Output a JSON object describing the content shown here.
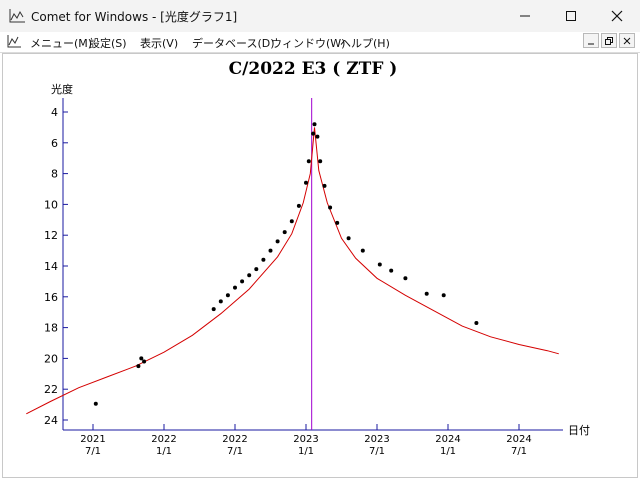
{
  "window": {
    "title": "Comet for Windows - [光度グラフ1]",
    "icon": "chart-icon"
  },
  "menu": {
    "items": [
      "メニュー(M)",
      "設定(S)",
      "表示(V)",
      "データベース(D)",
      "ウィンドウ(W)",
      "ヘルプ(H)"
    ]
  },
  "chart_data": {
    "type": "scatter",
    "title": "C/2022 E3 ( ZTF )",
    "ylabel": "光度",
    "xlabel": "日付",
    "ylim": [
      24,
      4
    ],
    "y_ticks": [
      4,
      6,
      8,
      10,
      12,
      14,
      16,
      18,
      20,
      22,
      24
    ],
    "x_ticks": [
      {
        "year": "2021",
        "date": "7/1",
        "t": 2021.5
      },
      {
        "year": "2022",
        "date": "1/1",
        "t": 2022.0
      },
      {
        "year": "2022",
        "date": "7/1",
        "t": 2022.5
      },
      {
        "year": "2023",
        "date": "1/1",
        "t": 2023.0
      },
      {
        "year": "2023",
        "date": "7/1",
        "t": 2023.5
      },
      {
        "year": "2024",
        "date": "1/1",
        "t": 2024.0
      },
      {
        "year": "2024",
        "date": "7/1",
        "t": 2024.5
      }
    ],
    "perihelion_date": 2023.04,
    "colors": {
      "curve": "#d40000",
      "points": "#000000",
      "marker": "#a000d0",
      "axis": "#1a1aa0"
    },
    "predicted_curve": [
      [
        2021.03,
        23.6
      ],
      [
        2021.2,
        22.8
      ],
      [
        2021.4,
        21.9
      ],
      [
        2021.6,
        21.2
      ],
      [
        2021.8,
        20.5
      ],
      [
        2022.0,
        19.6
      ],
      [
        2022.2,
        18.5
      ],
      [
        2022.4,
        17.1
      ],
      [
        2022.6,
        15.5
      ],
      [
        2022.8,
        13.4
      ],
      [
        2022.9,
        11.9
      ],
      [
        2022.98,
        9.9
      ],
      [
        2023.03,
        8.0
      ],
      [
        2023.06,
        5.0
      ],
      [
        2023.09,
        7.8
      ],
      [
        2023.15,
        9.9
      ],
      [
        2023.25,
        12.2
      ],
      [
        2023.35,
        13.5
      ],
      [
        2023.5,
        14.8
      ],
      [
        2023.7,
        15.9
      ],
      [
        2023.9,
        16.9
      ],
      [
        2024.1,
        17.9
      ],
      [
        2024.3,
        18.6
      ],
      [
        2024.5,
        19.1
      ],
      [
        2024.7,
        19.5
      ],
      [
        2024.78,
        19.7
      ]
    ],
    "observations": [
      [
        2021.52,
        22.95
      ],
      [
        2021.82,
        20.5
      ],
      [
        2021.84,
        20.0
      ],
      [
        2021.86,
        20.2
      ],
      [
        2022.35,
        16.8
      ],
      [
        2022.4,
        16.3
      ],
      [
        2022.45,
        15.9
      ],
      [
        2022.5,
        15.4
      ],
      [
        2022.55,
        15.0
      ],
      [
        2022.6,
        14.6
      ],
      [
        2022.65,
        14.2
      ],
      [
        2022.7,
        13.6
      ],
      [
        2022.75,
        13.0
      ],
      [
        2022.8,
        12.4
      ],
      [
        2022.85,
        11.8
      ],
      [
        2022.9,
        11.1
      ],
      [
        2022.95,
        10.1
      ],
      [
        2023.0,
        8.6
      ],
      [
        2023.02,
        7.2
      ],
      [
        2023.05,
        5.4
      ],
      [
        2023.06,
        4.8
      ],
      [
        2023.08,
        5.6
      ],
      [
        2023.1,
        7.2
      ],
      [
        2023.13,
        8.8
      ],
      [
        2023.17,
        10.2
      ],
      [
        2023.22,
        11.2
      ],
      [
        2023.3,
        12.2
      ],
      [
        2023.4,
        13.0
      ],
      [
        2023.52,
        13.9
      ],
      [
        2023.6,
        14.3
      ],
      [
        2023.7,
        14.8
      ],
      [
        2023.85,
        15.8
      ],
      [
        2023.97,
        15.9
      ],
      [
        2024.2,
        17.7
      ]
    ]
  }
}
